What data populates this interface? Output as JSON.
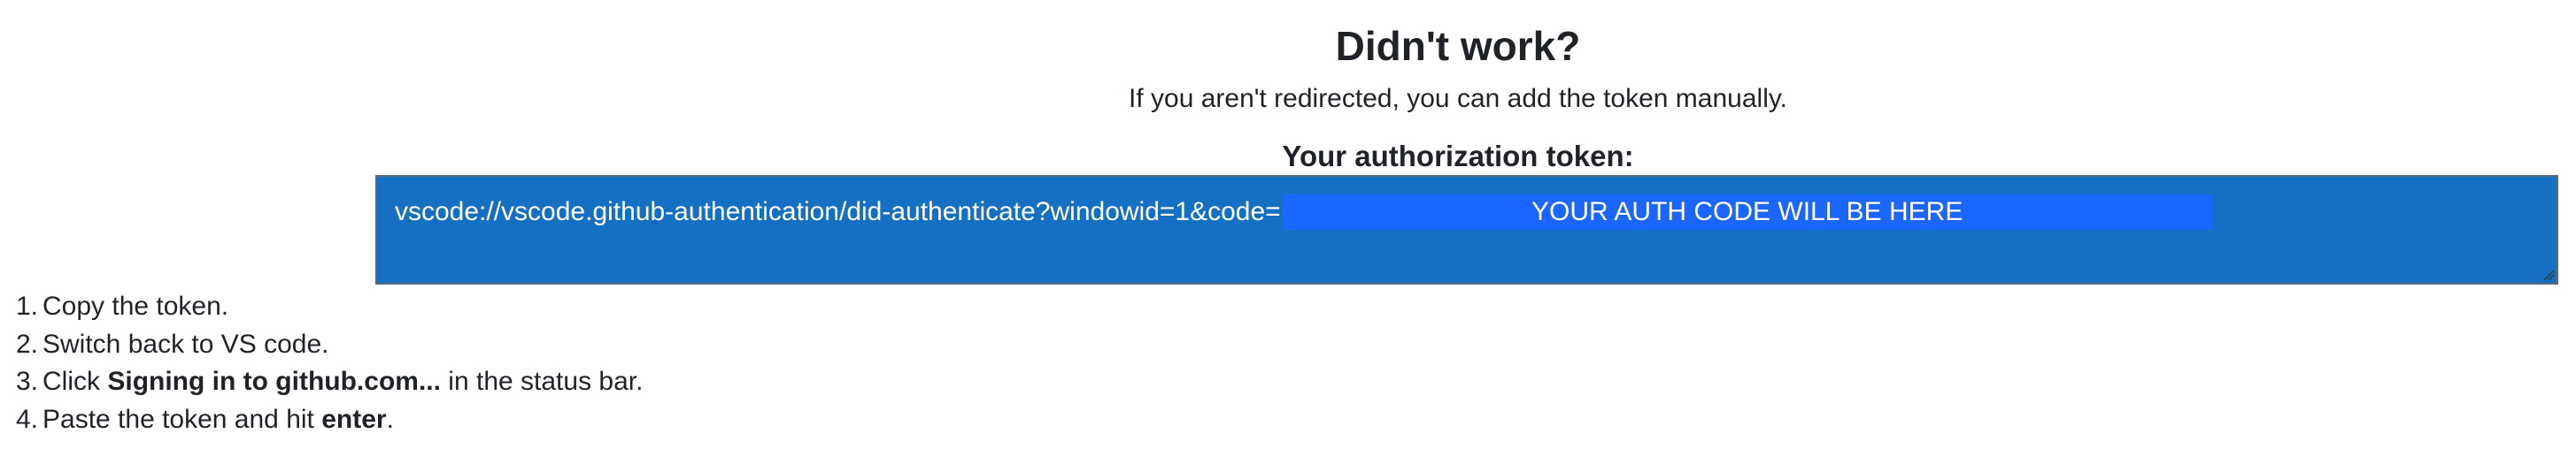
{
  "heading": {
    "title": "Didn't work?",
    "subtitle": "If you aren't redirected, you can add the token manually."
  },
  "token": {
    "label": "Your authorization token:",
    "prefix": "vscode://vscode.github-authentication/did-authenticate?windowid=1&code=",
    "code_placeholder": "YOUR AUTH CODE WILL BE HERE",
    "box_color": "#1570c4",
    "highlight_color": "#1a66ff"
  },
  "steps": [
    {
      "number": "1.",
      "text": "Copy the token."
    },
    {
      "number": "2.",
      "text": "Switch back to VS code."
    },
    {
      "number": "3.",
      "before": "Click ",
      "bold": "Signing in to github.com...",
      "after": " in the status bar."
    },
    {
      "number": "4.",
      "before": "Paste the token and hit ",
      "bold": "enter",
      "after": "."
    }
  ]
}
